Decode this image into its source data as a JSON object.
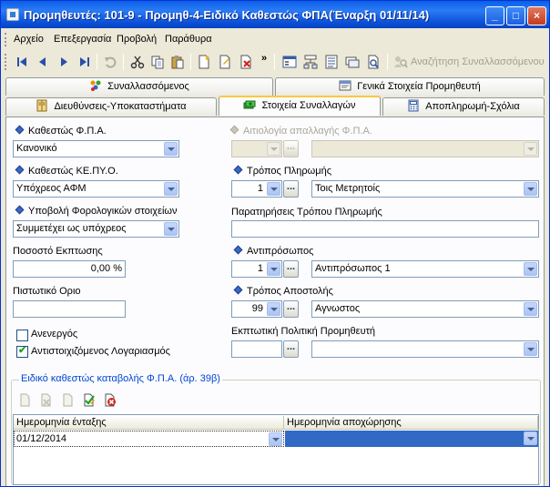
{
  "window": {
    "title": "Προμηθευτές: 101-9 - Προμηθ-4-Ειδικό Καθεστώς ΦΠΑ(Έναρξη 01/11/14)",
    "min_glyph": "_",
    "max_glyph": "□",
    "close_glyph": "×"
  },
  "menu": [
    "Αρχείο",
    "Επεξεργασία",
    "Προβολή",
    "Παράθυρα"
  ],
  "toolbar": {
    "overflow_glyph": "»",
    "search_label": "Αναζήτηση Συναλλασσόμενου"
  },
  "tabs_row1": [
    "Συναλλασσόμενος",
    "Γενικά Στοιχεία Προμηθευτή"
  ],
  "tabs_row2": [
    "Διευθύνσεις-Υποκαταστήματα",
    "Στοιχεία Συναλλαγών",
    "Αποπληρωμή-Σχόλια"
  ],
  "form": {
    "vat_status_label": "Καθεστώς Φ.Π.Α.",
    "vat_status_value": "Κανονικό",
    "kepyo_label": "Καθεστώς ΚΕ.ΠΥ.Ο.",
    "kepyo_value": "Υπόχρεος ΑΦΜ",
    "tax_submit_label": "Υποβολή Φορολογικών στοιχείων",
    "tax_submit_value": "Συμμετέχει ως υπόχρεος",
    "discount_label": "Ποσοστό Εκπτωσης",
    "discount_value": "0,00 %",
    "credit_label": "Πιστωτικό Οριο",
    "credit_value": "",
    "inactive_label": "Ανενεργός",
    "mapped_account_label": "Αντιστοιχιζόμενος Λογαριασμός",
    "vat_exemption_label": "Αιτιολογία απαλλαγής Φ.Π.Α.",
    "payment_method_label": "Τρόπος Πληρωμής",
    "payment_method_code": "1",
    "payment_method_value": "Τοις Μετρητοίς",
    "payment_notes_label": "Παρατηρήσεις Τρόπου Πληρωμής",
    "payment_notes_value": "",
    "representative_label": "Αντιπρόσωπος",
    "representative_code": "1",
    "representative_value": "Αντιπρόσωπος 1",
    "shipping_label": "Τρόπος Αποστολής",
    "shipping_code": "99",
    "shipping_value": "Αγνωστος",
    "discount_policy_label": "Εκπτωτική Πολιτική Προμηθευτή",
    "discount_policy_code": "",
    "discount_policy_value": "",
    "ellipsis": "..."
  },
  "vat_group": {
    "title": "Ειδικό καθεστώς καταβολής Φ.Π.Α. (άρ. 39β)",
    "columns": [
      "Ημερομηνία ένταξης",
      "Ημερομηνία αποχώρησης"
    ],
    "rows": [
      [
        "01/12/2014",
        ""
      ]
    ]
  },
  "colors": {
    "titlebar": "#0A5FE6",
    "window_bg": "#ECE9D8",
    "group_title": "#0046D5",
    "active_tab_accent": "#FFC83C",
    "selected_cell": "#316AC5"
  }
}
